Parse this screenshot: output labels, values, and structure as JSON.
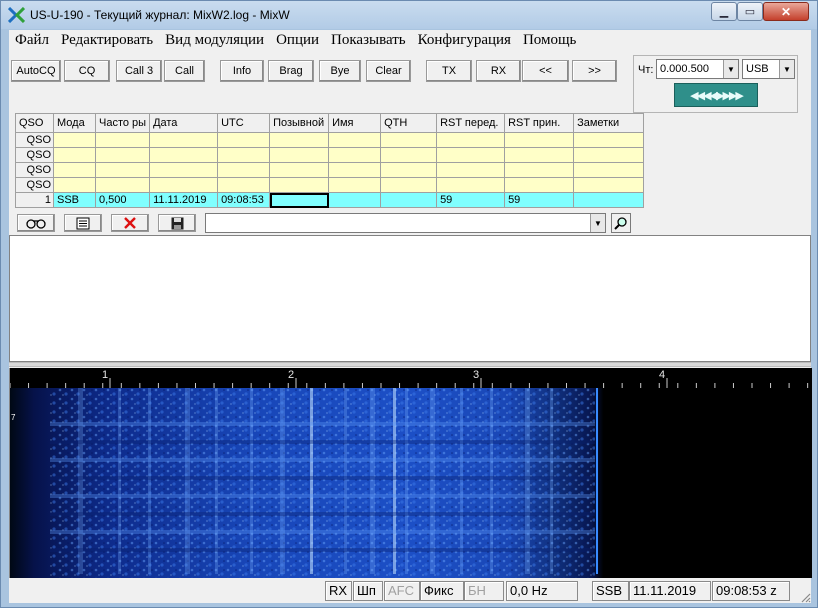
{
  "window": {
    "title": "US-U-190 - Текущий журнал: MixW2.log - MixW"
  },
  "menu": [
    "Файл",
    "Редактировать",
    "Вид модуляции",
    "Опции",
    "Показывать",
    "Конфигурация",
    "Помощь"
  ],
  "toolbar": {
    "autocq": "AutoCQ",
    "cq": "CQ",
    "call3": "Call 3",
    "call": "Call",
    "info": "Info",
    "brag": "Brag",
    "bye": "Bye",
    "clear": "Clear",
    "tx": "TX",
    "rx": "RX",
    "prev": "<<",
    "next": ">>"
  },
  "freq_panel": {
    "label": "Чт:",
    "freq_value": "0.000.500",
    "mode_value": "USB",
    "tune_glyphs": "◀◀◀◀▶▶▶▶"
  },
  "log": {
    "headers": [
      "QSO",
      "Мода",
      "Часто ры",
      "Дата",
      "UTC",
      "Позывной",
      "Имя",
      "QTH",
      "RST перед.",
      "RST прин.",
      "Заметки"
    ],
    "history_label": "QSO",
    "current": {
      "num": "1",
      "mode": "SSB",
      "freq": "0,500",
      "date": "11.11.2019",
      "utc": "09:08:53",
      "call": "",
      "name": "",
      "qth": "",
      "rst_sent": "59",
      "rst_rcvd": "59",
      "notes": ""
    }
  },
  "waterfall": {
    "scale": [
      "1",
      "2",
      "3",
      "4"
    ],
    "marker": "7"
  },
  "status": {
    "rx": "RX",
    "sh": "Шп",
    "afc": "AFC",
    "fix": "Фикс",
    "bn": "БН",
    "offset": "0,0 Hz",
    "mode": "SSB",
    "date": "11.11.2019",
    "time": "09:08:53 z"
  },
  "colors": {
    "log_bg": "#ffffc8",
    "current_row": "#80ffff",
    "tune_button": "#2f8f8a",
    "waterfall_bg": "#000000"
  }
}
